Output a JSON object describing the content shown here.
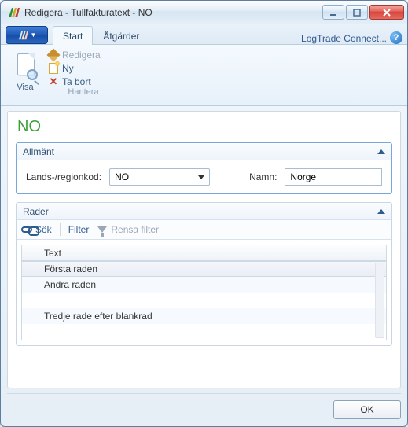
{
  "window": {
    "title": "Redigera - Tullfakturatext - NO"
  },
  "tabs": {
    "start": "Start",
    "actions": "Åtgärder"
  },
  "brand": "LogTrade Connect...",
  "ribbon": {
    "view_label": "Visa",
    "edit_label": "Redigera",
    "new_label": "Ny",
    "delete_label": "Ta bort",
    "group_label": "Hantera"
  },
  "page": {
    "title": "NO"
  },
  "general": {
    "header": "Allmänt",
    "country_label": "Lands-/regionkod:",
    "country_value": "NO",
    "name_label": "Namn:",
    "name_value": "Norge"
  },
  "lines": {
    "header": "Rader",
    "search_label": "Sök",
    "filter_label": "Filter",
    "clear_filter_label": "Rensa filter",
    "column_text": "Text",
    "rows": [
      "Första raden",
      "Andra raden",
      "",
      "Tredje rade efter blankrad"
    ]
  },
  "footer": {
    "ok_label": "OK"
  }
}
